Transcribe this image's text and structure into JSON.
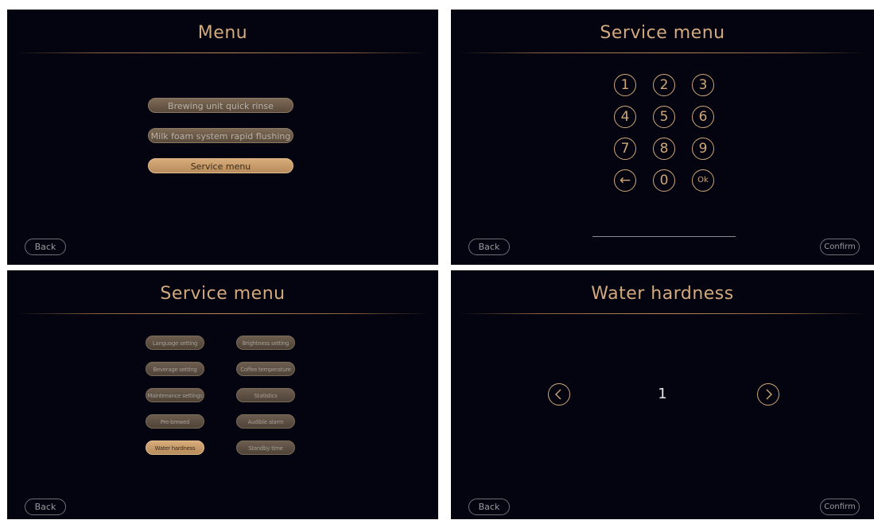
{
  "menu_screen": {
    "title": "Menu",
    "items": [
      {
        "label": "Brewing unit quick rinse",
        "active": false
      },
      {
        "label": "Milk foam system rapid flushing",
        "active": false
      },
      {
        "label": "Service menu",
        "active": true
      }
    ],
    "back_label": "Back"
  },
  "pin_screen": {
    "title": "Service menu",
    "keys": [
      "1",
      "2",
      "3",
      "4",
      "5",
      "6",
      "7",
      "8",
      "9",
      "←",
      "0",
      "Ok"
    ],
    "back_label": "Back",
    "confirm_label": "Confirm"
  },
  "service_screen": {
    "title": "Service menu",
    "left_items": [
      {
        "label": "Language setting",
        "active": false
      },
      {
        "label": "Beverage setting",
        "active": false
      },
      {
        "label": "Maintenance settings",
        "active": false
      },
      {
        "label": "Pre-brewed",
        "active": false
      },
      {
        "label": "Water hardness",
        "active": true
      }
    ],
    "right_items": [
      {
        "label": "Brightness setting",
        "active": false
      },
      {
        "label": "Coffee temperature",
        "active": false
      },
      {
        "label": "Statistics",
        "active": false
      },
      {
        "label": "Audible alarm",
        "active": false
      },
      {
        "label": "Standby time",
        "active": false
      }
    ],
    "back_label": "Back"
  },
  "hardness_screen": {
    "title": "Water hardness",
    "value": "1",
    "back_label": "Back",
    "confirm_label": "Confirm"
  },
  "colors": {
    "accent": "#d3a97d",
    "panel_bg": "#03040f",
    "active_button": "#c89a68"
  }
}
